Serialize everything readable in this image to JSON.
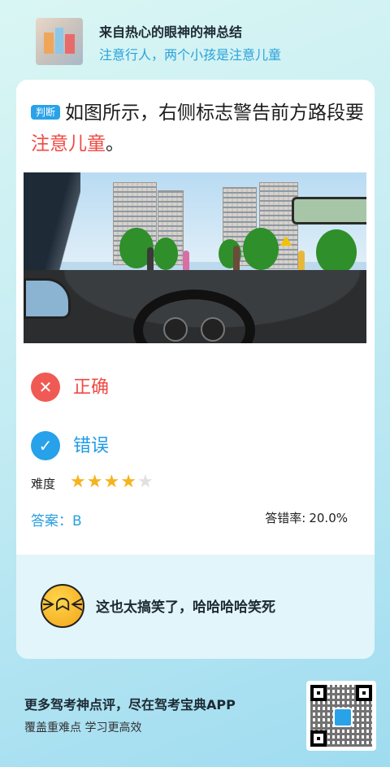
{
  "header": {
    "title": "来自热心的眼神的神总结",
    "subtitle": "注意行人，两个小孩是注意儿童"
  },
  "question": {
    "tag": "判断",
    "text_before": "如图所示，右侧标志警告前方路段要",
    "highlight": "注意儿童",
    "text_after": "。"
  },
  "options": [
    {
      "label": "正确",
      "icon": "close-icon",
      "color": "#f05a55"
    },
    {
      "label": "错误",
      "icon": "check-icon",
      "color": "#26a1ea"
    }
  ],
  "difficulty": {
    "label": "难度",
    "rating": 4,
    "max": 5
  },
  "answer": {
    "label": "答案：B",
    "error_rate_label": "答错率:",
    "error_rate_value": "20.0%"
  },
  "comment": {
    "emoji": "laughing-crying-emoji",
    "text": "这也太搞笑了，哈哈哈哈笑死"
  },
  "footer": {
    "title": "更多驾考神点评，尽在驾考宝典APP",
    "subtitle": "覆盖重难点 学习更高效"
  },
  "colors": {
    "accent_blue": "#2aa2e8",
    "accent_red": "#ef4a42",
    "star": "#f5b31c"
  }
}
